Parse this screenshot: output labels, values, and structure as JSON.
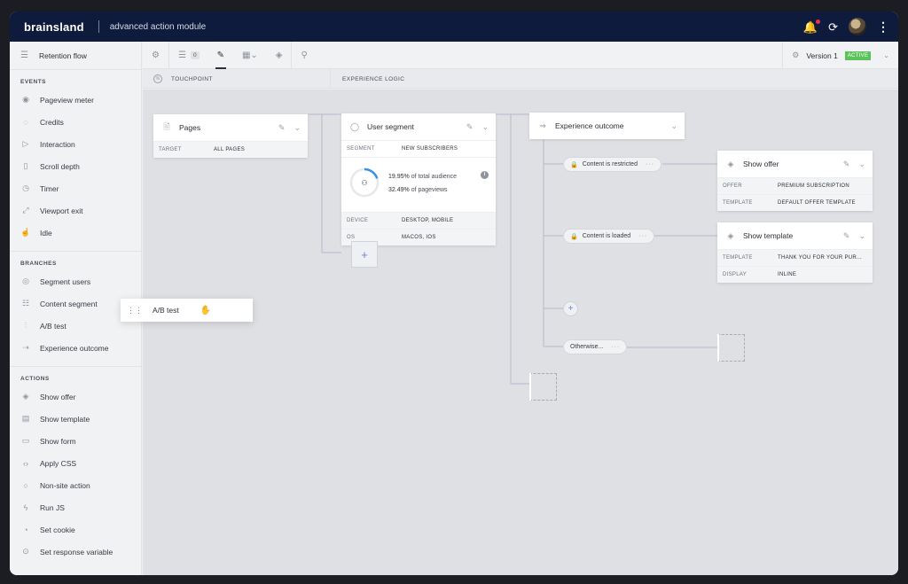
{
  "app": {
    "brand": "brainsland",
    "module": "advanced action module"
  },
  "topbar": {
    "icons": [
      "bell-icon",
      "history-icon",
      "avatar",
      "kebab-icon"
    ]
  },
  "sidebar": {
    "title": "Retention flow",
    "sections": {
      "events": "EVENTS",
      "branches": "BRANCHES",
      "actions": "ACTIONS"
    },
    "events": [
      {
        "label": "Pageview meter",
        "icon": "eye-icon"
      },
      {
        "label": "Credits",
        "icon": "credits-icon"
      },
      {
        "label": "Interaction",
        "icon": "pointer-icon"
      },
      {
        "label": "Scroll depth",
        "icon": "scroll-icon"
      },
      {
        "label": "Timer",
        "icon": "clock-icon"
      },
      {
        "label": "Viewport exit",
        "icon": "exit-icon"
      },
      {
        "label": "Idle",
        "icon": "idle-icon"
      }
    ],
    "branches": [
      {
        "label": "Segment users",
        "icon": "user-circle-icon"
      },
      {
        "label": "Content segment",
        "icon": "content-icon"
      },
      {
        "label": "A/B test",
        "icon": "ab-test-icon"
      },
      {
        "label": "Experience outcome",
        "icon": "outcome-icon"
      }
    ],
    "actions": [
      {
        "label": "Show offer",
        "icon": "layers-icon"
      },
      {
        "label": "Show template",
        "icon": "template-icon"
      },
      {
        "label": "Show form",
        "icon": "form-icon"
      },
      {
        "label": "Apply CSS",
        "icon": "code-icon"
      },
      {
        "label": "Non-site action",
        "icon": "circle-icon"
      },
      {
        "label": "Run JS",
        "icon": "bolt-icon"
      },
      {
        "label": "Set cookie",
        "icon": "cookie-icon"
      },
      {
        "label": "Set response variable",
        "icon": "variable-icon"
      }
    ]
  },
  "toolbar": {
    "badge": "0",
    "version": "Version 1",
    "status": "ACTIVE"
  },
  "columns": {
    "touchpoint": "TOUCHPOINT",
    "logic": "EXPERIENCE LOGIC"
  },
  "cards": {
    "pages": {
      "title": "Pages",
      "rows": [
        {
          "k": "TARGET",
          "v": "ALL PAGES"
        }
      ]
    },
    "segment": {
      "title": "User segment",
      "segment_k": "SEGMENT",
      "segment_v": "NEW SUBSCRIBERS",
      "audience_pct": "19.95%",
      "audience_text": "of total audience",
      "pageviews_pct": "32.49%",
      "pageviews_text": "of pageviews",
      "ring_fraction": 0.1995,
      "rows": [
        {
          "k": "DEVICE",
          "v": "DESKTOP, MOBILE"
        },
        {
          "k": "OS",
          "v": "MACOS, IOS"
        }
      ]
    },
    "outcome": {
      "title": "Experience outcome"
    },
    "offer": {
      "title": "Show offer",
      "rows": [
        {
          "k": "OFFER",
          "v": "PREMIUM SUBSCRIPTION"
        },
        {
          "k": "TEMPLATE",
          "v": "DEFAULT OFFER TEMPLATE"
        }
      ]
    },
    "template": {
      "title": "Show template",
      "rows": [
        {
          "k": "TEMPLATE",
          "v": "THANK YOU FOR YOUR PUR..."
        },
        {
          "k": "DISPLAY",
          "v": "INLINE"
        }
      ]
    }
  },
  "pills": {
    "restricted": "Content is restricted",
    "loaded": "Content is loaded",
    "otherwise": "Otherwise..."
  },
  "drag": {
    "label": "A/B test"
  },
  "colors": {
    "topbar": "#0f1b3d",
    "accent": "#6b7fd7",
    "active": "#5cc35c",
    "ring": "#3b8ee6"
  }
}
